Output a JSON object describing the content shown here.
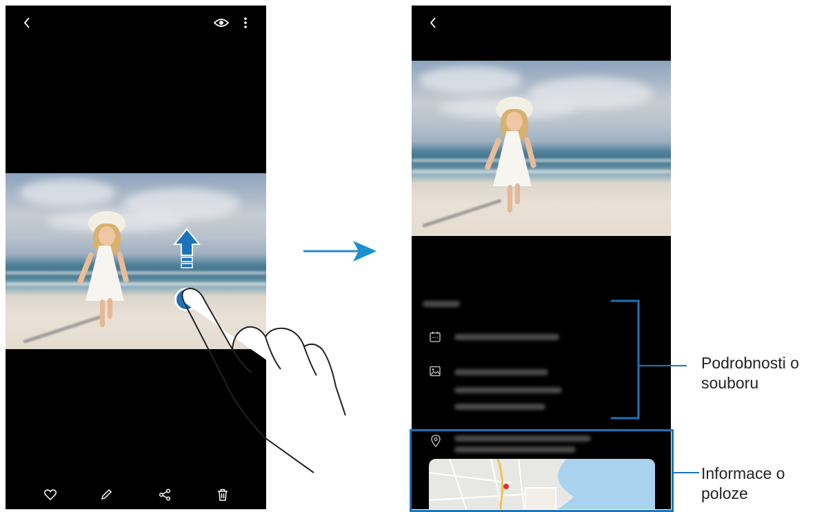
{
  "left_screen": {
    "top_bar": {
      "back_icon": "chevron-left-icon",
      "eye_icon": "eye-icon",
      "more_icon": "more-vertical-icon"
    },
    "bottom_bar": {
      "favorite_icon": "heart-icon",
      "edit_icon": "pencil-icon",
      "share_icon": "share-icon",
      "delete_icon": "trash-icon"
    },
    "gesture": {
      "swipe_direction": "up",
      "highlight_color": "#1b74bb"
    }
  },
  "transition_arrow": {
    "color": "#1b8fcf"
  },
  "right_screen": {
    "top_bar": {
      "back_icon": "chevron-left-icon"
    },
    "details": {
      "date_icon": "calendar-icon",
      "file_icon": "image-icon"
    },
    "location": {
      "location_icon": "location-pin-icon"
    }
  },
  "callouts": {
    "bracket_color": "#1b74bb",
    "file_details": "Podrobnosti o\nsouboru",
    "location_info": "Informace o\npoloze"
  }
}
